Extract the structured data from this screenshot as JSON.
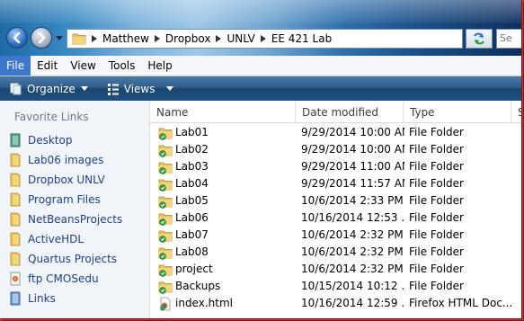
{
  "address": {
    "crumbs": [
      "Matthew",
      "Dropbox",
      "UNLV",
      "EE 421 Lab"
    ],
    "search_placeholder": "Se"
  },
  "menu": {
    "items": [
      "File",
      "Edit",
      "View",
      "Tools",
      "Help"
    ],
    "active": "File"
  },
  "toolbar": {
    "organize_label": "Organize",
    "views_label": "Views"
  },
  "nav": {
    "title": "Favorite Links",
    "items": [
      {
        "label": "Desktop",
        "icon": "desktop-icon"
      },
      {
        "label": "Lab06 images",
        "icon": "folder-icon"
      },
      {
        "label": "Dropbox UNLV",
        "icon": "folder-icon"
      },
      {
        "label": "Program Files",
        "icon": "folder-icon"
      },
      {
        "label": "NetBeansProjects",
        "icon": "folder-icon"
      },
      {
        "label": "ActiveHDL",
        "icon": "folder-icon"
      },
      {
        "label": "Quartus Projects",
        "icon": "folder-icon"
      },
      {
        "label": "ftp CMOSedu",
        "icon": "ftp-icon"
      },
      {
        "label": "Links",
        "icon": "links-icon"
      }
    ]
  },
  "columns": {
    "name": "Name",
    "date": "Date modified",
    "type": "Type",
    "size": "S"
  },
  "files": [
    {
      "name": "Lab01",
      "date": "9/29/2014 10:00 AM",
      "type": "File Folder",
      "icon": "synced-folder-icon"
    },
    {
      "name": "Lab02",
      "date": "9/29/2014 10:00 AM",
      "type": "File Folder",
      "icon": "synced-folder-icon"
    },
    {
      "name": "Lab03",
      "date": "9/29/2014 11:00 AM",
      "type": "File Folder",
      "icon": "synced-folder-icon"
    },
    {
      "name": "Lab04",
      "date": "9/29/2014 11:57 AM",
      "type": "File Folder",
      "icon": "synced-folder-icon"
    },
    {
      "name": "Lab05",
      "date": "10/6/2014 2:33 PM",
      "type": "File Folder",
      "icon": "synced-folder-icon"
    },
    {
      "name": "Lab06",
      "date": "10/16/2014 12:53 ...",
      "type": "File Folder",
      "icon": "synced-folder-icon"
    },
    {
      "name": "Lab07",
      "date": "10/6/2014 2:32 PM",
      "type": "File Folder",
      "icon": "synced-folder-icon"
    },
    {
      "name": "Lab08",
      "date": "10/6/2014 2:32 PM",
      "type": "File Folder",
      "icon": "synced-folder-icon"
    },
    {
      "name": "project",
      "date": "10/6/2014 2:32 PM",
      "type": "File Folder",
      "icon": "synced-folder-icon"
    },
    {
      "name": "Backups",
      "date": "10/15/2014 10:12 ...",
      "type": "File Folder",
      "icon": "synced-folder-icon"
    },
    {
      "name": "index.html",
      "date": "10/16/2014 12:59 ...",
      "type": "Firefox HTML Doc...",
      "icon": "html-file-icon"
    }
  ]
}
